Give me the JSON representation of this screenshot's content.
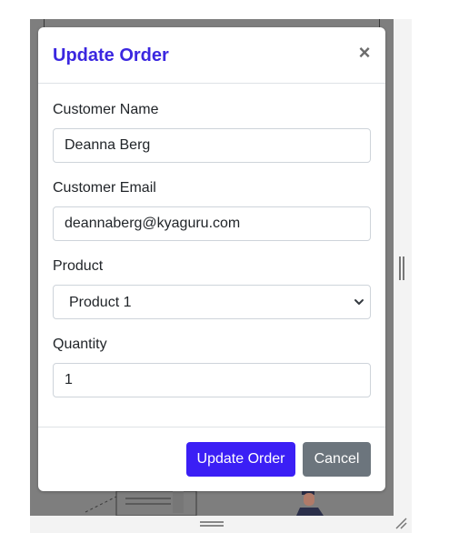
{
  "modal": {
    "title": "Update Order",
    "close_icon": "close-icon",
    "close_glyph": "×"
  },
  "form": {
    "customer_name": {
      "label": "Customer Name",
      "value": "Deanna Berg"
    },
    "customer_email": {
      "label": "Customer Email",
      "value": "deannaberg@kyaguru.com"
    },
    "product": {
      "label": "Product",
      "selected": "Product 1",
      "icon": "chevron-down-icon"
    },
    "quantity": {
      "label": "Quantity",
      "value": "1"
    }
  },
  "footer": {
    "update_label": "Update Order",
    "cancel_label": "Cancel"
  },
  "colors": {
    "title": "#3b27e0",
    "primary_button": "#3b1ff5",
    "secondary_button": "#6c757d",
    "backdrop": "#7e7e7e"
  }
}
